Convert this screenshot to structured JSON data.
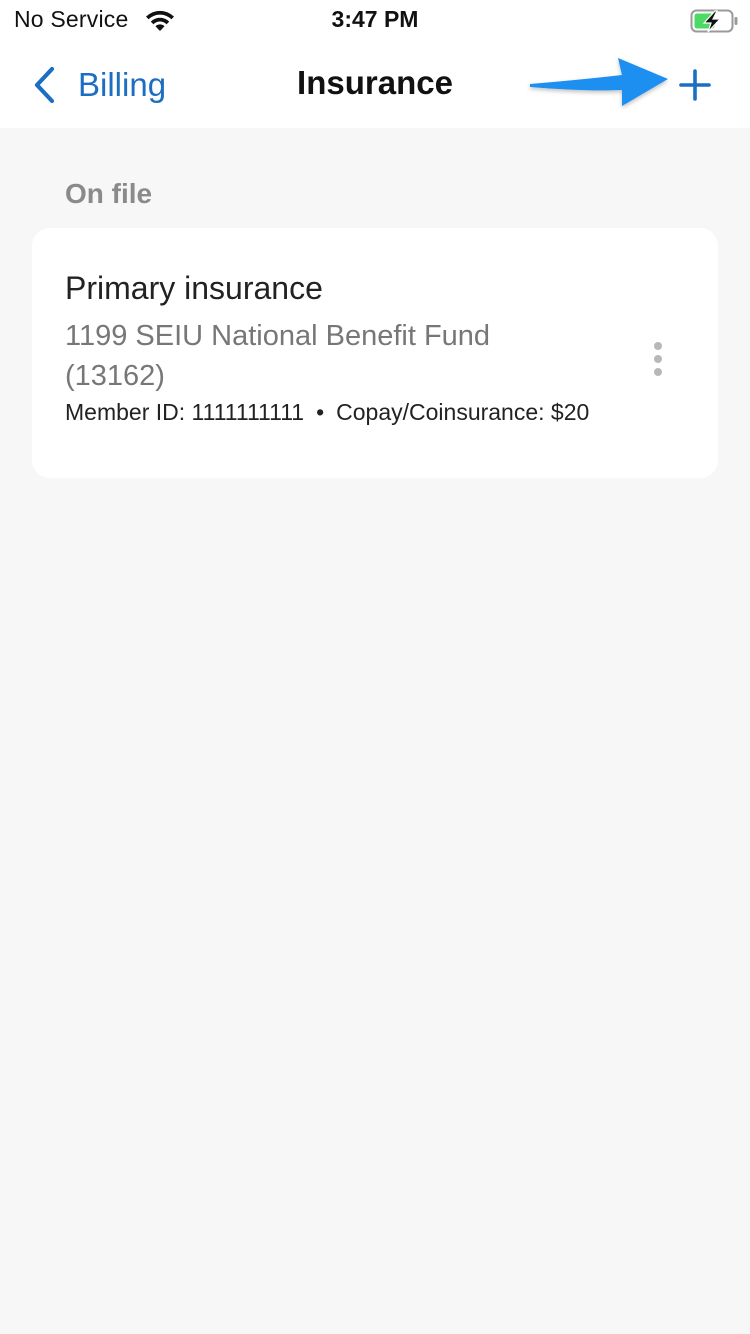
{
  "status_bar": {
    "carrier": "No Service",
    "time": "3:47 PM",
    "wifi_icon": "wifi-icon",
    "battery_icon": "battery-charging-icon"
  },
  "nav": {
    "back_label": "Billing",
    "title": "Insurance",
    "add_icon": "plus-icon"
  },
  "colors": {
    "accent": "#1b6ec2",
    "annotation_arrow": "#1e8ff0",
    "background": "#f7f7f7",
    "card": "#ffffff"
  },
  "section": {
    "label": "On file"
  },
  "insurance_card": {
    "title": "Primary insurance",
    "provider": "1199 SEIU National Benefit Fund (13162)",
    "member_id": "Member ID: 1111111111",
    "separator": "•",
    "copay": "Copay/Coinsurance: $20",
    "menu_icon": "more-vertical-icon"
  }
}
